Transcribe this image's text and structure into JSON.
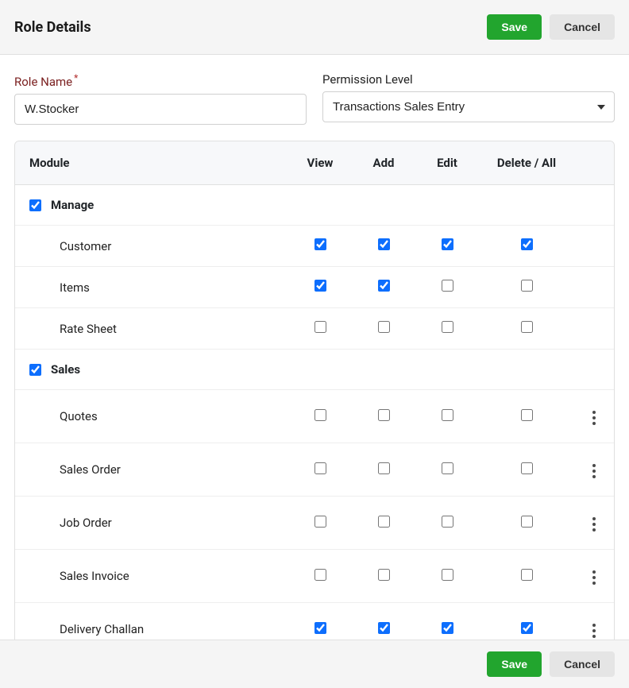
{
  "header": {
    "title": "Role Details",
    "save_label": "Save",
    "cancel_label": "Cancel"
  },
  "form": {
    "role_name_label": "Role Name",
    "role_name_value": "W.Stocker",
    "permission_level_label": "Permission Level",
    "permission_level_value": "Transactions Sales Entry"
  },
  "table": {
    "columns": {
      "module": "Module",
      "view": "View",
      "add": "Add",
      "edit": "Edit",
      "delete": "Delete / All"
    },
    "sections": [
      {
        "name": "Manage",
        "checked": true,
        "rows": [
          {
            "label": "Customer",
            "view": true,
            "add": true,
            "edit": true,
            "delete": true,
            "has_menu": false
          },
          {
            "label": "Items",
            "view": true,
            "add": true,
            "edit": false,
            "delete": false,
            "has_menu": false
          },
          {
            "label": "Rate Sheet",
            "view": false,
            "add": false,
            "edit": false,
            "delete": false,
            "has_menu": false
          }
        ]
      },
      {
        "name": "Sales",
        "checked": true,
        "rows": [
          {
            "label": "Quotes",
            "view": false,
            "add": false,
            "edit": false,
            "delete": false,
            "has_menu": true
          },
          {
            "label": "Sales Order",
            "view": false,
            "add": false,
            "edit": false,
            "delete": false,
            "has_menu": true
          },
          {
            "label": "Job Order",
            "view": false,
            "add": false,
            "edit": false,
            "delete": false,
            "has_menu": true
          },
          {
            "label": "Sales Invoice",
            "view": false,
            "add": false,
            "edit": false,
            "delete": false,
            "has_menu": true
          },
          {
            "label": "Delivery Challan",
            "view": true,
            "add": true,
            "edit": true,
            "delete": true,
            "has_menu": true
          }
        ]
      }
    ]
  },
  "footer": {
    "save_label": "Save",
    "cancel_label": "Cancel"
  }
}
